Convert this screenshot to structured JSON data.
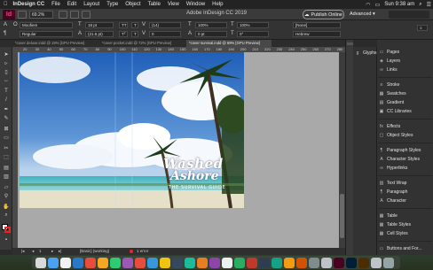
{
  "menubar": {
    "app": "InDesign CC",
    "items": [
      "File",
      "Edit",
      "Layout",
      "Type",
      "Object",
      "Table",
      "View",
      "Window",
      "Help"
    ],
    "clock": "Sun 9:38 am",
    "battery": "100%"
  },
  "appbar": {
    "logo": "Id",
    "zoom": "69.2%",
    "title": "Adobe InDesign CC 2019",
    "publish": "Publish Online",
    "workspace": "Advanced"
  },
  "control": {
    "font": "Moofiem",
    "style": "Regular",
    "size": "18 pt",
    "leading": "(21.6 pt)",
    "kern": "(14)",
    "tracking": "0",
    "scale_v": "100%",
    "scale_h": "100%",
    "baseline": "0 pt",
    "skew": "0°",
    "char_style": "[None]",
    "language": "Hebrew"
  },
  "tabs": [
    "*cover deluxe.indd @ 19% [GPU Preview]",
    "*cover pocket.indd @ 72% [GPU Preview]",
    "*cover survival.indd @ 69% [GPU Preview]"
  ],
  "ruler_numbers": [
    "20",
    "30",
    "40",
    "50",
    "60",
    "70",
    "80",
    "90",
    "100",
    "110",
    "120",
    "130",
    "140",
    "150",
    "160",
    "170",
    "180",
    "190",
    "200",
    "210",
    "220",
    "230",
    "240",
    "250",
    "260",
    "270",
    "280"
  ],
  "artwork": {
    "title_line1": "Washed",
    "title_line2": "Ashore",
    "tagline": "THE SURVIVAL GUIDE"
  },
  "status": {
    "page": "1",
    "style": "[Basic] (working)",
    "errors": "1 error"
  },
  "panels": {
    "glyphs": "Glyphs",
    "items": [
      {
        "label": "Pages",
        "icon": "pages-icon",
        "glyph": "▭"
      },
      {
        "label": "Layers",
        "icon": "layers-icon",
        "glyph": "◈"
      },
      {
        "label": "Links",
        "icon": "links-icon",
        "glyph": "∞"
      },
      {
        "label": "Stroke",
        "icon": "stroke-icon",
        "glyph": "≡"
      },
      {
        "label": "Swatches",
        "icon": "swatches-icon",
        "glyph": "▦"
      },
      {
        "label": "Gradient",
        "icon": "gradient-icon",
        "glyph": "▤"
      },
      {
        "label": "CC Libraries",
        "icon": "cc-libraries-icon",
        "glyph": "▣"
      },
      {
        "label": "Effects",
        "icon": "effects-icon",
        "glyph": "fx"
      },
      {
        "label": "Object Styles",
        "icon": "object-styles-icon",
        "glyph": "▢"
      },
      {
        "label": "Paragraph Styles",
        "icon": "paragraph-styles-icon",
        "glyph": "¶"
      },
      {
        "label": "Character Styles",
        "icon": "character-styles-icon",
        "glyph": "A"
      },
      {
        "label": "Hyperlinks",
        "icon": "hyperlinks-icon",
        "glyph": "∞"
      },
      {
        "label": "Text Wrap",
        "icon": "text-wrap-icon",
        "glyph": "▥"
      },
      {
        "label": "Paragraph",
        "icon": "paragraph-icon",
        "glyph": "¶"
      },
      {
        "label": "Character",
        "icon": "character-icon",
        "glyph": "A"
      },
      {
        "label": "Table",
        "icon": "table-icon",
        "glyph": "▦"
      },
      {
        "label": "Table Styles",
        "icon": "table-styles-icon",
        "glyph": "▦"
      },
      {
        "label": "Cell Styles",
        "icon": "cell-styles-icon",
        "glyph": "▦"
      },
      {
        "label": "Buttons and For...",
        "icon": "buttons-icon",
        "glyph": "▭"
      }
    ]
  },
  "colors": {
    "accent": "#ff3e8e",
    "id_bg": "#49021f",
    "ui_dark": "#323232",
    "pasteboard": "#a9a9a9"
  }
}
